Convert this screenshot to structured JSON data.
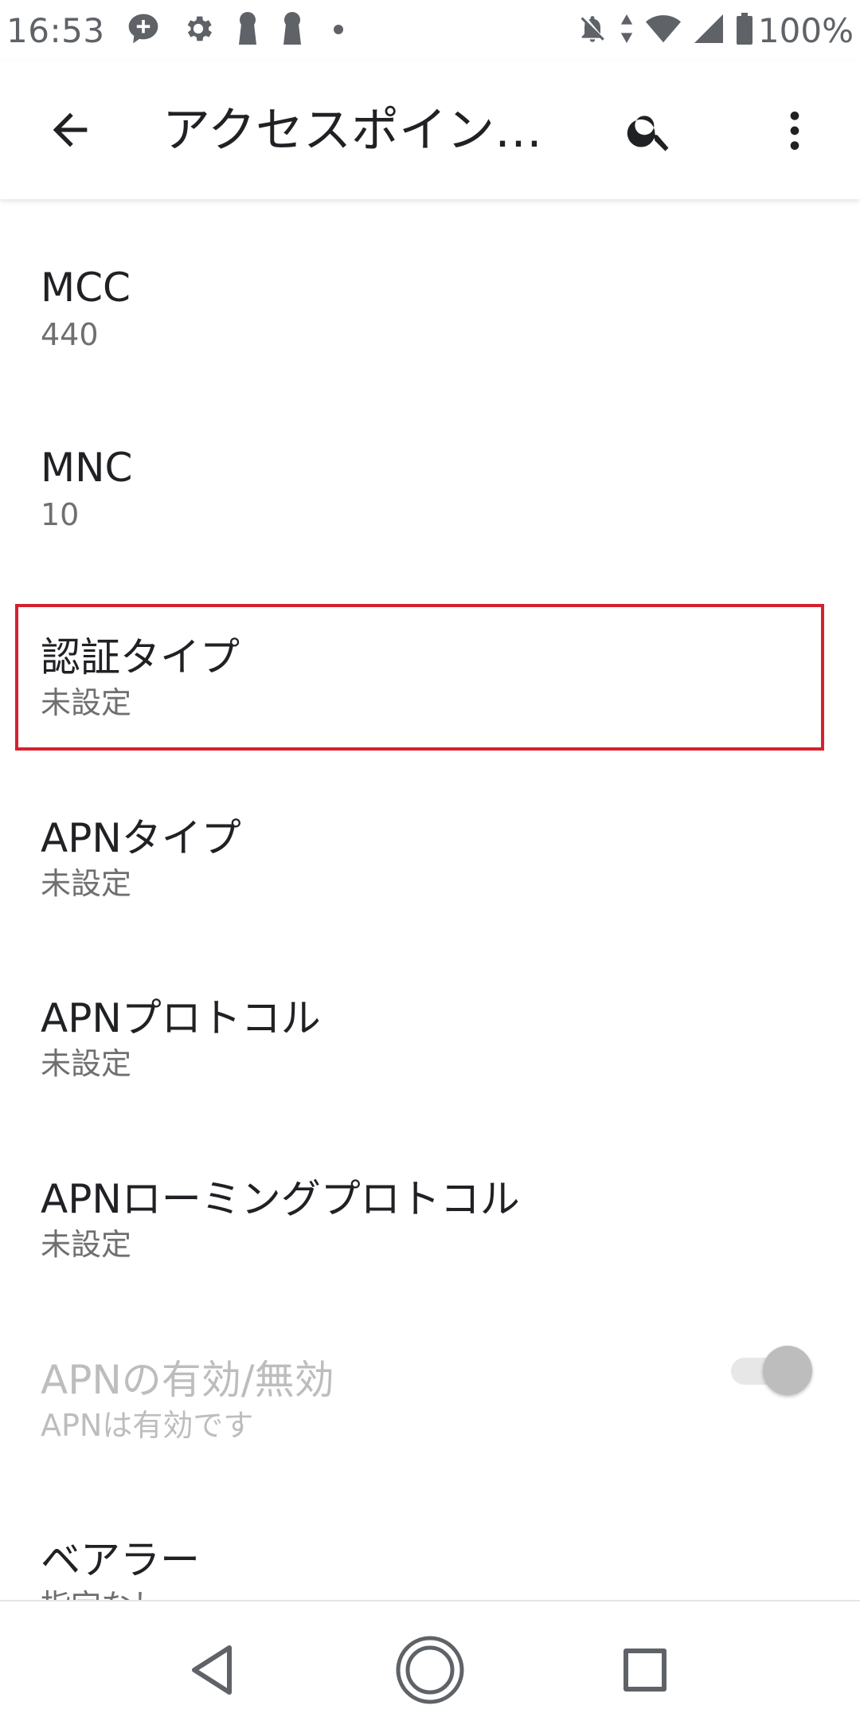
{
  "status_bar": {
    "time": "16:53",
    "battery_percent": "100%",
    "left_icons": [
      "chat-plus-icon",
      "gear-icon",
      "keyhole-icon",
      "keyhole-icon",
      "dot-icon"
    ],
    "right_icons": [
      "bell-off-icon",
      "data-arrows-icon",
      "wifi-icon",
      "signal-icon",
      "battery-icon"
    ]
  },
  "app_bar": {
    "title": "アクセスポイン…",
    "icons": [
      "back-arrow-icon",
      "search-icon",
      "more-vert-icon"
    ]
  },
  "items": [
    {
      "title": "MCC",
      "summary": "440"
    },
    {
      "title": "MNC",
      "summary": "10"
    },
    {
      "title": "認証タイプ",
      "summary": "未設定",
      "highlighted": true
    },
    {
      "title": "APNタイプ",
      "summary": "未設定"
    },
    {
      "title": "APNプロトコル",
      "summary": "未設定"
    },
    {
      "title": "APNローミングプロトコル",
      "summary": "未設定"
    },
    {
      "title": "APNの有効/無効",
      "summary": "APNは有効です",
      "disabled": true,
      "toggle_on": true
    },
    {
      "title": "ベアラー",
      "summary": "指定なし"
    }
  ],
  "colors": {
    "highlight_border": "#d5212f",
    "text_primary": "#202124",
    "text_secondary": "#6f6f6f",
    "text_disabled": "#bdbdbd"
  },
  "nav_bar": {
    "icons": [
      "back-triangle-icon",
      "home-circle-icon",
      "recents-square-icon"
    ]
  }
}
